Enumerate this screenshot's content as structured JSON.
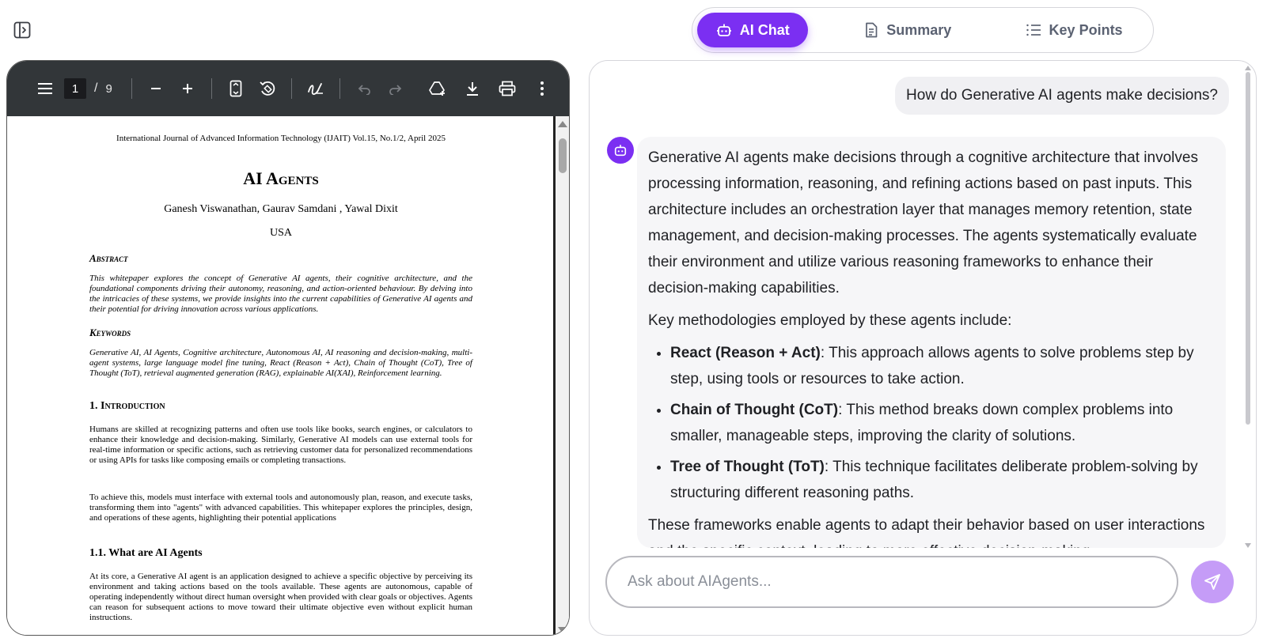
{
  "tabs": [
    {
      "label": "AI Chat",
      "icon": "bot-icon",
      "active": true
    },
    {
      "label": "Summary",
      "icon": "document-icon",
      "active": false
    },
    {
      "label": "Key Points",
      "icon": "list-icon",
      "active": false
    }
  ],
  "pdf": {
    "toolbar": {
      "current_page": "1",
      "separator": "/",
      "total_pages": "9"
    },
    "page": {
      "journal": "International Journal of Advanced Information Technology (IJAIT) Vol.15, No.1/2, April 2025",
      "title": "AI Agents",
      "authors": "Ganesh Viswanathan, Gaurav Samdani , Yawal Dixit",
      "country": "USA",
      "abstract_head": "Abstract",
      "abstract": "This whitepaper explores the concept of Generative AI agents, their cognitive architecture, and the foundational components driving their autonomy, reasoning, and action-oriented behaviour. By delving into the intricacies of these systems, we provide insights into the current capabilities of Generative AI agents and their potential for driving innovation across various applications.",
      "keywords_head": "Keywords",
      "keywords": "Generative AI, AI Agents, Cognitive architecture, Autonomous AI, AI reasoning and decision-making, multi-agent systems, large language model fine tuning, React (Reason + Act), Chain of Thought (CoT), Tree of Thought (ToT), retrieval augmented generation (RAG), explainable AI(XAI), Reinforcement learning.",
      "intro_head": "1. Introduction",
      "intro_p1": "Humans are skilled at recognizing patterns and often use tools like books, search engines, or calculators to enhance their knowledge and decision-making. Similarly, Generative AI models can use external tools for real-time information or specific actions, such as retrieving customer data for personalized recommendations or using APIs for tasks like composing emails or completing transactions.",
      "intro_p2": "To achieve this, models must interface with external tools and autonomously plan, reason, and execute tasks, transforming them into \"agents\" with advanced capabilities. This whitepaper explores the principles, design, and operations of these agents, highlighting their potential applications",
      "sub_head": "1.1. What are AI Agents",
      "sub_p1": "At its core, a Generative AI agent is an application designed to achieve a specific objective by perceiving its environment and taking actions based on the tools available. These agents are autonomous, capable of operating independently without direct human oversight when provided with clear goals or objectives. Agents can reason for subsequent actions to move toward their ultimate objective even without explicit human instructions."
    }
  },
  "chat": {
    "user_message": "How do Generative AI agents make decisions?",
    "bot": {
      "p1": "Generative AI agents make decisions through a cognitive architecture that involves processing information, reasoning, and refining actions based on past inputs. This architecture includes an orchestration layer that manages memory retention, state management, and decision-making processes. The agents systematically evaluate their environment and utilize various reasoning frameworks to enhance their decision-making capabilities.",
      "p2": "Key methodologies employed by these agents include:",
      "items": [
        {
          "term": "React (Reason + Act)",
          "text": ": This approach allows agents to solve problems step by step, using tools or resources to take action."
        },
        {
          "term": "Chain of Thought (CoT)",
          "text": ": This method breaks down complex problems into smaller, manageable steps, improving the clarity of solutions."
        },
        {
          "term": "Tree of Thought (ToT)",
          "text": ": This technique facilitates deliberate problem-solving by structuring different reasoning paths."
        }
      ],
      "p3": "These frameworks enable agents to adapt their behavior based on user interactions and the specific context, leading to more effective decision-making."
    },
    "input_placeholder": "Ask about AIAgents..."
  },
  "colors": {
    "accent": "#7b2ff2",
    "send_button": "#c59cf7",
    "toolbar": "#323639"
  }
}
